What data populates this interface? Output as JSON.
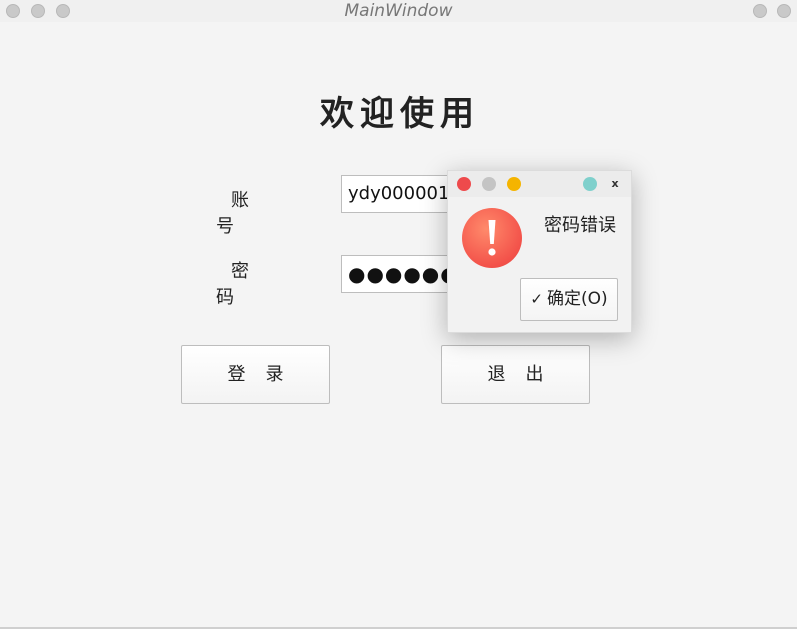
{
  "window": {
    "title": "MainWindow"
  },
  "form": {
    "heading": "欢迎使用",
    "account_label": "账号",
    "account_value": "ydy000001",
    "password_label": "密码",
    "password_mask": "●●●●●●",
    "login_label": "登录",
    "exit_label": "退出"
  },
  "dialog": {
    "message": "密码错误",
    "ok_label": "确定(O)",
    "close_glyph": "x",
    "check_glyph": "✓"
  },
  "colors": {
    "dialog_close": "#ee4a4c",
    "dialog_minimize": "#c4c4c4",
    "dialog_maximize": "#f5b400",
    "dialog_extra": "#7fd0cc",
    "warning_icon": "#f3524a"
  }
}
